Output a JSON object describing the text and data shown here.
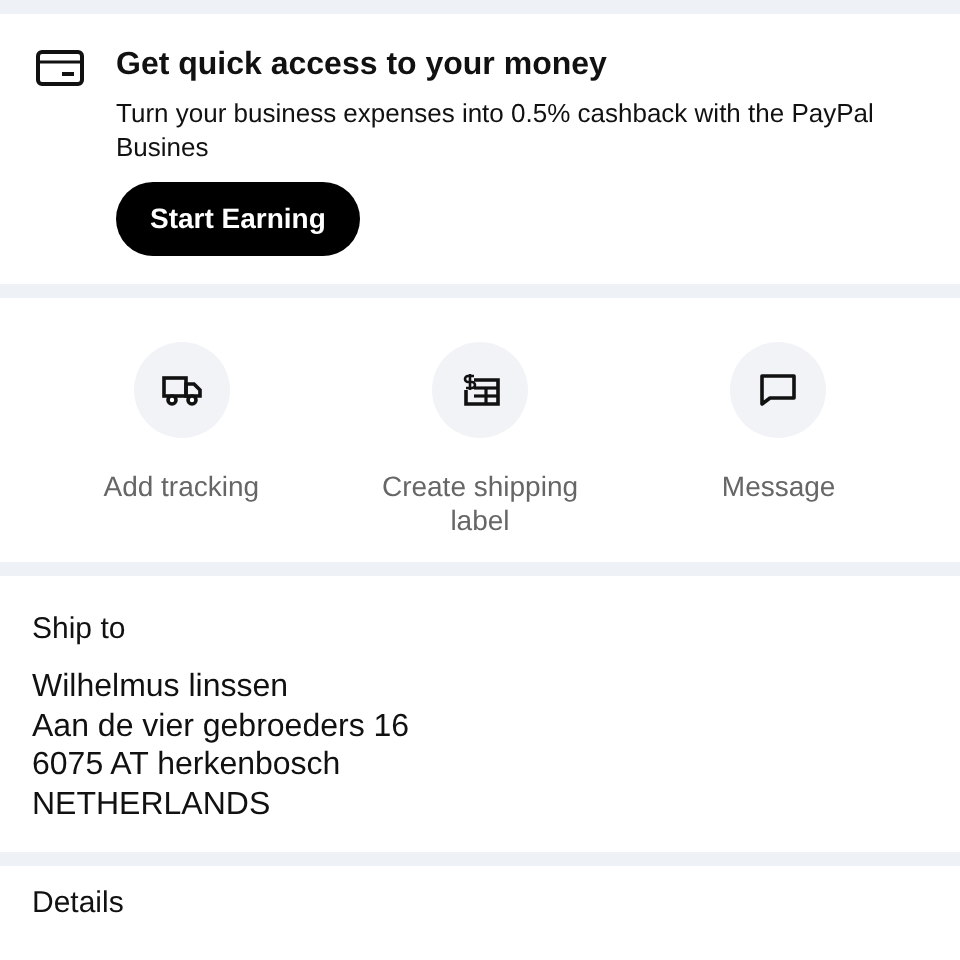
{
  "promo": {
    "title": "Get quick access to your money",
    "text": "Turn your business expenses into 0.5% cashback with the PayPal Busines",
    "button": "Start Earning"
  },
  "actions": [
    {
      "kind": "truck",
      "label": "Add tracking"
    },
    {
      "kind": "label",
      "label": "Create shipping label"
    },
    {
      "kind": "message",
      "label": "Message"
    }
  ],
  "ship_to": {
    "heading": "Ship to",
    "lines": [
      "Wilhelmus linssen",
      "Aan de vier gebroeders 16",
      "6075 AT herkenbosch",
      "NETHERLANDS"
    ]
  },
  "details": {
    "heading": "Details"
  }
}
